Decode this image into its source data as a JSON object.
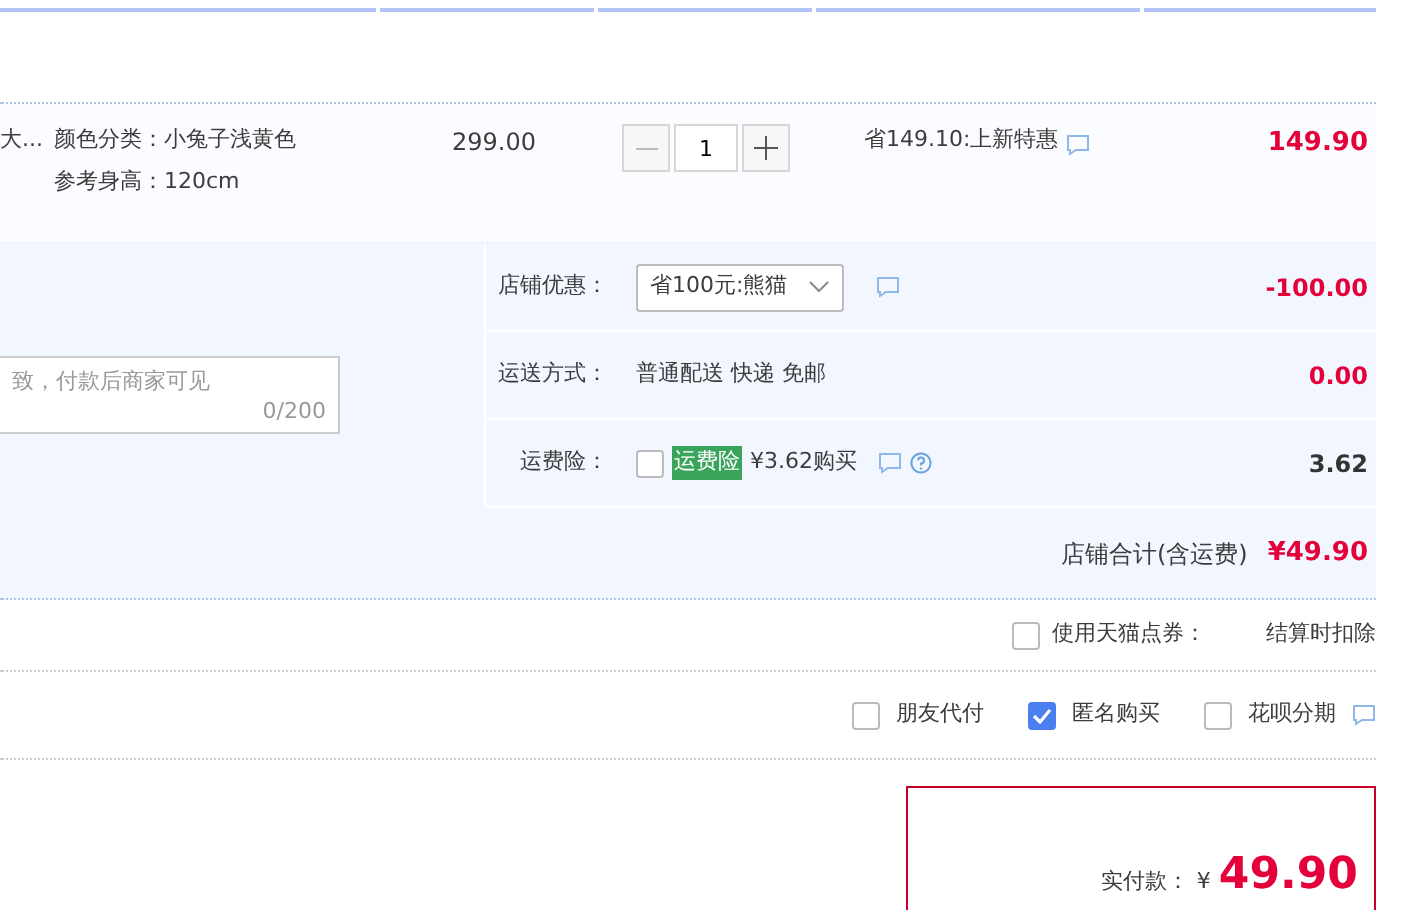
{
  "product": {
    "title": "大...",
    "props": [
      "颜色分类：小兔子浅黄色",
      "参考身高：120cm"
    ],
    "price": "299.00",
    "quantity": {
      "value": "1"
    },
    "promo": "省149.10:上新特惠",
    "subtotal": "149.90"
  },
  "message": {
    "placeholder": "致，付款后商家可见",
    "counter": "0/200"
  },
  "shop_rows": [
    {
      "kind": "select",
      "label": "店铺优惠：",
      "value": "省100元:熊猫",
      "amount": "-100.00",
      "emphasis": true
    },
    {
      "kind": "text",
      "label": "运送方式：",
      "value": "普通配送 快递 免邮",
      "amount": "0.00",
      "emphasis": true
    },
    {
      "kind": "checkbox",
      "label": "运费险：",
      "checked": false,
      "tag": "运费险",
      "value": "¥3.62购买",
      "amount": "3.62",
      "emphasis": false
    }
  ],
  "shop_total": {
    "label": "店铺合计(含运费)",
    "amount": "¥49.90"
  },
  "coupon": {
    "checked": false,
    "label": "使用天猫点券：",
    "note": "结算时扣除"
  },
  "options": [
    {
      "label": "朋友代付",
      "checked": false
    },
    {
      "label": "匿名购买",
      "checked": true
    },
    {
      "label": "花呗分期",
      "checked": false
    }
  ],
  "payment": {
    "label": "实付款：",
    "currency": "¥",
    "amount": "49.90"
  }
}
